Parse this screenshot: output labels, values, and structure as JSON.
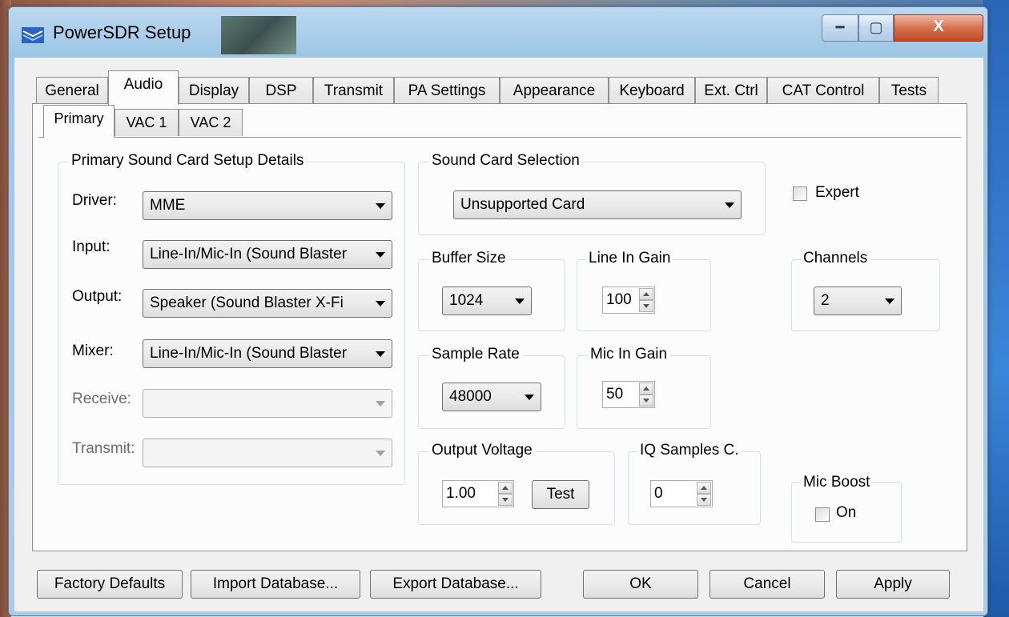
{
  "window": {
    "title": "PowerSDR Setup",
    "minimize_glyph": "━",
    "maximize_glyph": "▢",
    "close_glyph": "X"
  },
  "tabs": [
    {
      "label": "General"
    },
    {
      "label": "Audio"
    },
    {
      "label": "Display"
    },
    {
      "label": "DSP"
    },
    {
      "label": "Transmit"
    },
    {
      "label": "PA Settings"
    },
    {
      "label": "Appearance"
    },
    {
      "label": "Keyboard"
    },
    {
      "label": "Ext. Ctrl"
    },
    {
      "label": "CAT Control"
    },
    {
      "label": "Tests"
    }
  ],
  "active_tab": "Audio",
  "subtabs": [
    {
      "label": "Primary"
    },
    {
      "label": "VAC 1"
    },
    {
      "label": "VAC 2"
    }
  ],
  "primary_group": {
    "title": "Primary Sound Card Setup Details",
    "driver": {
      "label": "Driver:",
      "value": "MME"
    },
    "input": {
      "label": "Input:",
      "value": "Line-In/Mic-In (Sound Blaster"
    },
    "output": {
      "label": "Output:",
      "value": "Speaker (Sound Blaster X-Fi"
    },
    "mixer": {
      "label": "Mixer:",
      "value": "Line-In/Mic-In (Sound Blaster"
    },
    "receive": {
      "label": "Receive:",
      "value": ""
    },
    "transmit": {
      "label": "Transmit:",
      "value": ""
    }
  },
  "sound_card": {
    "title": "Sound Card Selection",
    "value": "Unsupported Card"
  },
  "expert": {
    "label": "Expert",
    "checked": false
  },
  "buffer_size": {
    "title": "Buffer Size",
    "value": "1024"
  },
  "line_in_gain": {
    "title": "Line In Gain",
    "value": "100"
  },
  "channels": {
    "title": "Channels",
    "value": "2"
  },
  "sample_rate": {
    "title": "Sample Rate",
    "value": "48000"
  },
  "mic_in_gain": {
    "title": "Mic In Gain",
    "value": "50"
  },
  "output_voltage": {
    "title": "Output Voltage",
    "value": "1.00",
    "test_label": "Test"
  },
  "iq_samples": {
    "title": "IQ Samples C.",
    "value": "0"
  },
  "mic_boost": {
    "title": "Mic Boost",
    "on_label": "On",
    "checked": false
  },
  "footer": {
    "factory_defaults": "Factory Defaults",
    "import_database": "Import Database...",
    "export_database": "Export Database...",
    "ok": "OK",
    "cancel": "Cancel",
    "apply": "Apply"
  }
}
